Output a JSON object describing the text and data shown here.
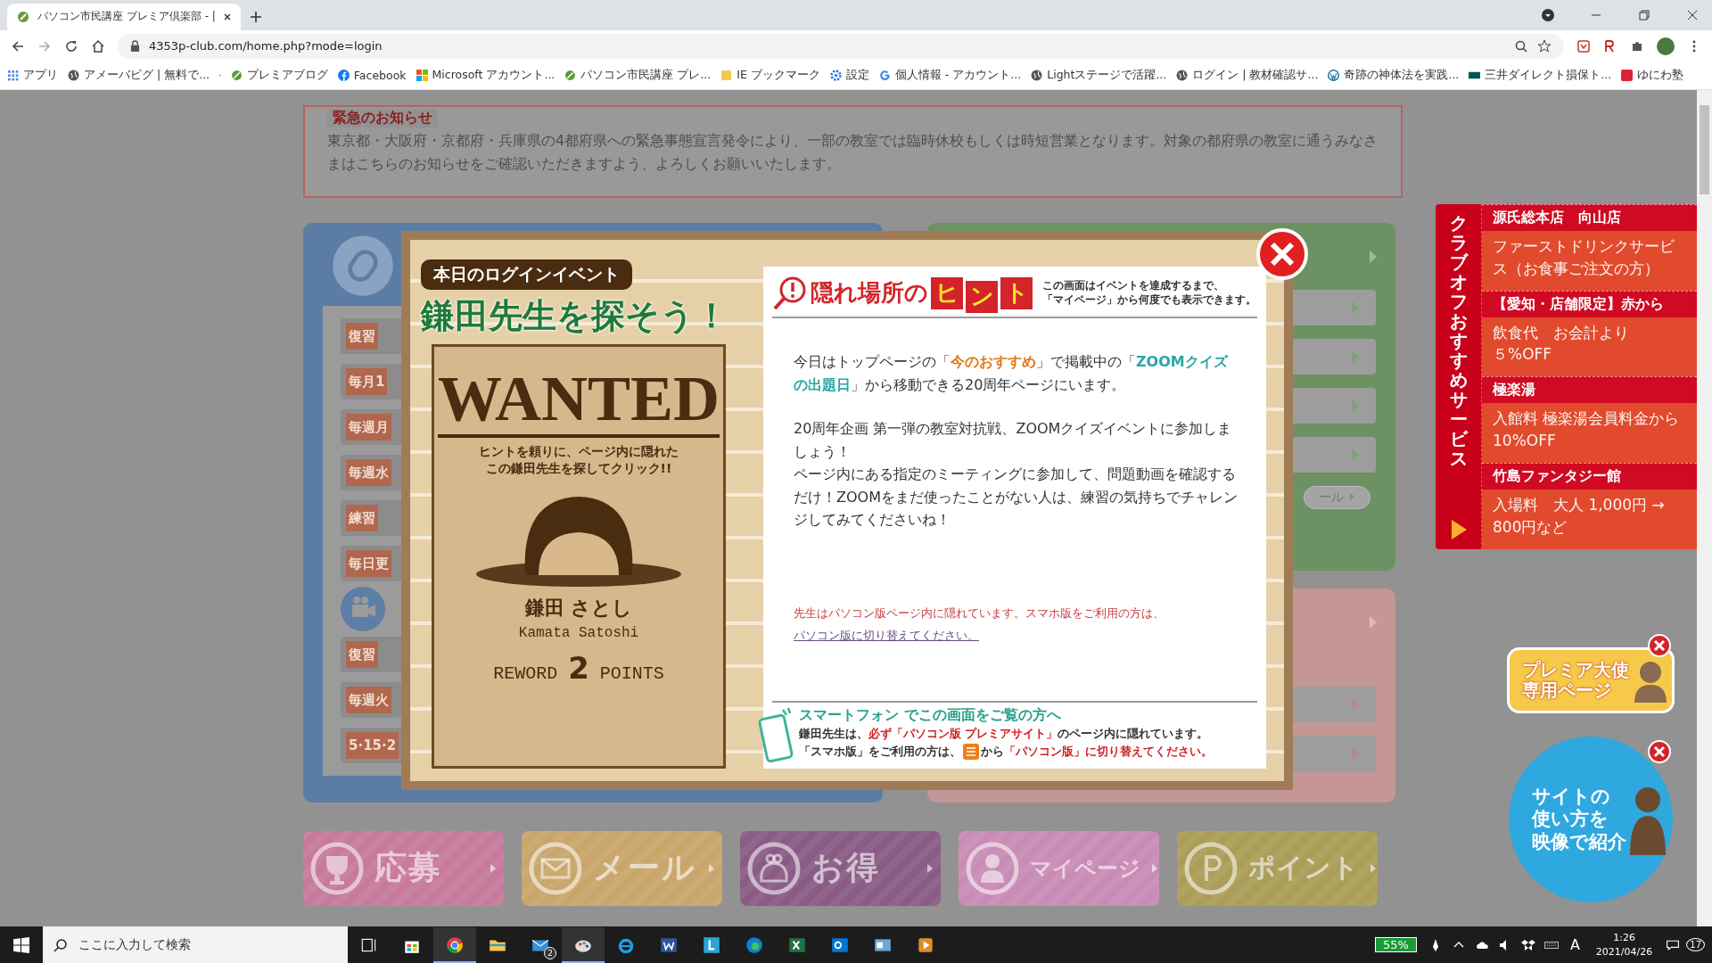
{
  "browser": {
    "tab_title": "パソコン市民講座 プレミア倶楽部 - |",
    "url": "4353p-club.com/home.php?mode=login",
    "bookmarks": [
      {
        "label": "アプリ"
      },
      {
        "label": "アメーバピグ | 無料で..."
      },
      {
        "label": "プレミアブログ"
      },
      {
        "label": "Facebook"
      },
      {
        "label": "Microsoft アカウント..."
      },
      {
        "label": "パソコン市民講座 プレ..."
      },
      {
        "label": "IE ブックマーク"
      },
      {
        "label": "設定"
      },
      {
        "label": "個人情報 - アカウント..."
      },
      {
        "label": "Lightステージで活躍..."
      },
      {
        "label": "ログイン | 教材確認サ..."
      },
      {
        "label": "奇跡の神体法を実践..."
      },
      {
        "label": "三井ダイレクト損保ト..."
      },
      {
        "label": "ゆにわ塾"
      }
    ]
  },
  "notice": {
    "title": "緊急のお知らせ",
    "text": "東京都・大阪府・京都府・兵庫県の4都府県への緊急事態宣言発令により、一部の教室では臨時休校もしくは時短営業となります。対象の都府県の教室に通うみなさまはこちらのお知らせをご確認いただきますよう、よろしくお願いいたします。"
  },
  "course_panel": {
    "rows": [
      {
        "kind": "label",
        "text": "復習"
      },
      {
        "kind": "label",
        "text": "毎月1"
      },
      {
        "kind": "label",
        "text": "毎週月"
      },
      {
        "kind": "label",
        "text": "毎週水"
      },
      {
        "kind": "label",
        "text": "練習"
      },
      {
        "kind": "label",
        "text": "毎日更"
      },
      {
        "kind": "section"
      },
      {
        "kind": "label",
        "text": "復習"
      },
      {
        "kind": "label",
        "text": "毎週火"
      },
      {
        "kind": "label",
        "text": "5·15·2"
      }
    ]
  },
  "green_panel": {
    "button": "ール"
  },
  "bottom_buttons": [
    {
      "label": "応募",
      "color": "#c77a9b"
    },
    {
      "label": "メール",
      "color": "#c9a66b"
    },
    {
      "label": "お得",
      "color": "#8a5c85"
    },
    {
      "label": "マイページ",
      "color": "#c98cb6"
    },
    {
      "label": "ポイント",
      "color": "#aa9e58"
    }
  ],
  "modal": {
    "badge": "本日のログインイベント",
    "heading": "鎌田先生を探そう！",
    "poster": {
      "title": "WANTED",
      "hint_lines": [
        "ヒントを頼りに、ページ内に隠れた",
        "この鎌田先生を探してクリック!!"
      ],
      "name": "鎌田 さとし",
      "romaji": "Kamata Satoshi",
      "reward": "REWORD **2** POINTS"
    },
    "hint_title": "隠れ場所の",
    "hint_tiles": [
      "ヒ",
      "ン",
      "ト"
    ],
    "hint_note": [
      "この画面はイベントを達成するまで、",
      "「マイページ」から何度でも表示できます。"
    ],
    "paragraphs": [
      [
        {
          "kind": "plain",
          "text": "今日はトップページの「"
        },
        {
          "kind": "emphasis",
          "text": "今のおすすめ"
        },
        {
          "kind": "plain",
          "text": "」で掲載中の「"
        },
        {
          "kind": "link",
          "text": "ZOOMクイズの出題日"
        },
        {
          "kind": "plain",
          "text": "」から移動できる20周年ページにいます。"
        }
      ],
      [
        {
          "kind": "plain",
          "text": "20周年企画 第一弾の教室対抗戦、ZOOMクイズイベントに参加しましょう！"
        }
      ],
      [
        {
          "kind": "plain",
          "text": "ページ内にある指定のミーティングに参加して、問題動画を確認するだけ！ZOOMをまだ使ったことがない人は、練習の気持ちでチャレンジしてみてくださいね！"
        }
      ]
    ],
    "warning": {
      "text": "先生はパソコン版ページ内に隠れています。スマホ版をご利用の方は、",
      "link": "パソコン版に切り替えてください。"
    },
    "phone_title": "スマートフォン でこの画面をご覧の方へ",
    "phone_lines": [
      [
        {
          "kind": "plain",
          "text": "鎌田先生は、"
        },
        {
          "kind": "alert",
          "text": "必ず「パソコン版 プレミアサイト」"
        },
        {
          "kind": "plain",
          "text": "のページ内に隠れています。"
        }
      ],
      [
        {
          "kind": "plain",
          "text": "「スマホ版」をご利用の方は、"
        },
        {
          "kind": "menu_icon"
        },
        {
          "kind": "plain",
          "text": " から"
        },
        {
          "kind": "alert",
          "text": "「パソコン版」に切り替えてください。"
        }
      ]
    ]
  },
  "sidebar": {
    "title": "クラブオフおすすめサービス",
    "offers": [
      {
        "name": "源氏総本店　向山店",
        "detail": [
          "ファーストドリンクサービス（お食事ご注文の方）"
        ]
      },
      {
        "name": "【愛知・店舗限定】赤から",
        "detail": [
          "飲食代　お会計より",
          "５%OFF"
        ]
      },
      {
        "name": "極楽湯",
        "detail": [
          "入館料 極楽湯会員料金から10%OFF"
        ]
      },
      {
        "name": "竹島ファンタジー館",
        "detail": [
          "入場料　大人 1,000円 → 800円など"
        ]
      }
    ]
  },
  "floating": {
    "ambassador": [
      "プレミア大使",
      "専用ページ"
    ],
    "video": [
      "サイトの",
      "使い方を",
      "映像で紹介"
    ]
  },
  "taskbar": {
    "search_placeholder": "ここに入力して検索",
    "mail_badge": "2",
    "battery": "55%",
    "ime": "A",
    "time": "1:26",
    "date": "2021/04/26",
    "notifications": "17"
  }
}
